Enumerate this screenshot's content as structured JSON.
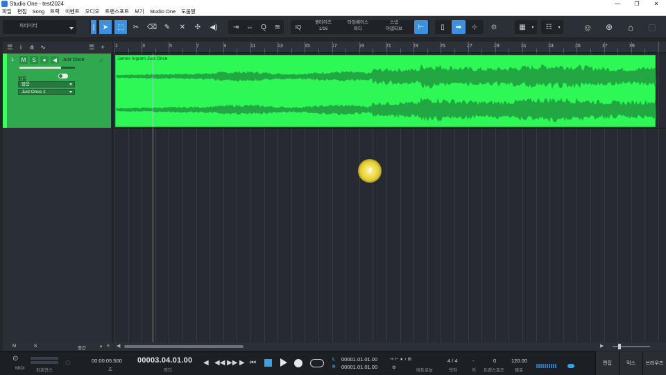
{
  "window": {
    "title": "Studio One - test2024",
    "controls": [
      "—",
      "❐",
      "✕"
    ]
  },
  "menu": [
    "파일",
    "편집",
    "Song",
    "트랙",
    "이벤트",
    "오디오",
    "트랜스포트",
    "보기",
    "Studio One",
    "도움말"
  ],
  "toolbar": {
    "parameter_label": "파라미터",
    "iq_label": "IQ",
    "quantize": {
      "label": "퀀타이즈",
      "value": "1/16"
    },
    "timebase": {
      "label": "타임베이스",
      "value": "마디"
    },
    "snap": {
      "label": "스냅",
      "value": "어댑티브"
    }
  },
  "track": {
    "number": "1",
    "mute": "M",
    "solo": "S",
    "name": "Just Once",
    "input_label": "없음",
    "input_value": "없음",
    "output_value": "Just Once 1"
  },
  "ruler": {
    "bars": [
      "1",
      "3",
      "5",
      "7",
      "9",
      "11",
      "13",
      "15",
      "17",
      "19",
      "21",
      "23",
      "25",
      "27",
      "29",
      "31",
      "33",
      "35",
      "37",
      "39"
    ]
  },
  "clip": {
    "name": "James Ingram Just Once",
    "color": "#2ef855"
  },
  "footer": {
    "m": "M",
    "s": "S",
    "mid_label": "중간"
  },
  "transport": {
    "midi_label": "MIDI",
    "perf_label": "퍼포먼스",
    "seconds": "00:00:05.500",
    "seconds_unit": "초",
    "position": "00003.04.01.00",
    "position_unit": "마디",
    "loop_l": "00001.01.01.00",
    "loop_r": "00001.01.01.00",
    "l_label": "L",
    "r_label": "R",
    "metronome_label": "메트로놈",
    "signature": "4 / 4",
    "signature_label": "박자",
    "key_val": "-",
    "key_label": "키",
    "transpose_val": "0",
    "transpose_label": "트랜스포즈",
    "tempo": "120.00",
    "tempo_label": "템포"
  },
  "lower_tabs": [
    "편집",
    "믹스",
    "브라우즈"
  ]
}
